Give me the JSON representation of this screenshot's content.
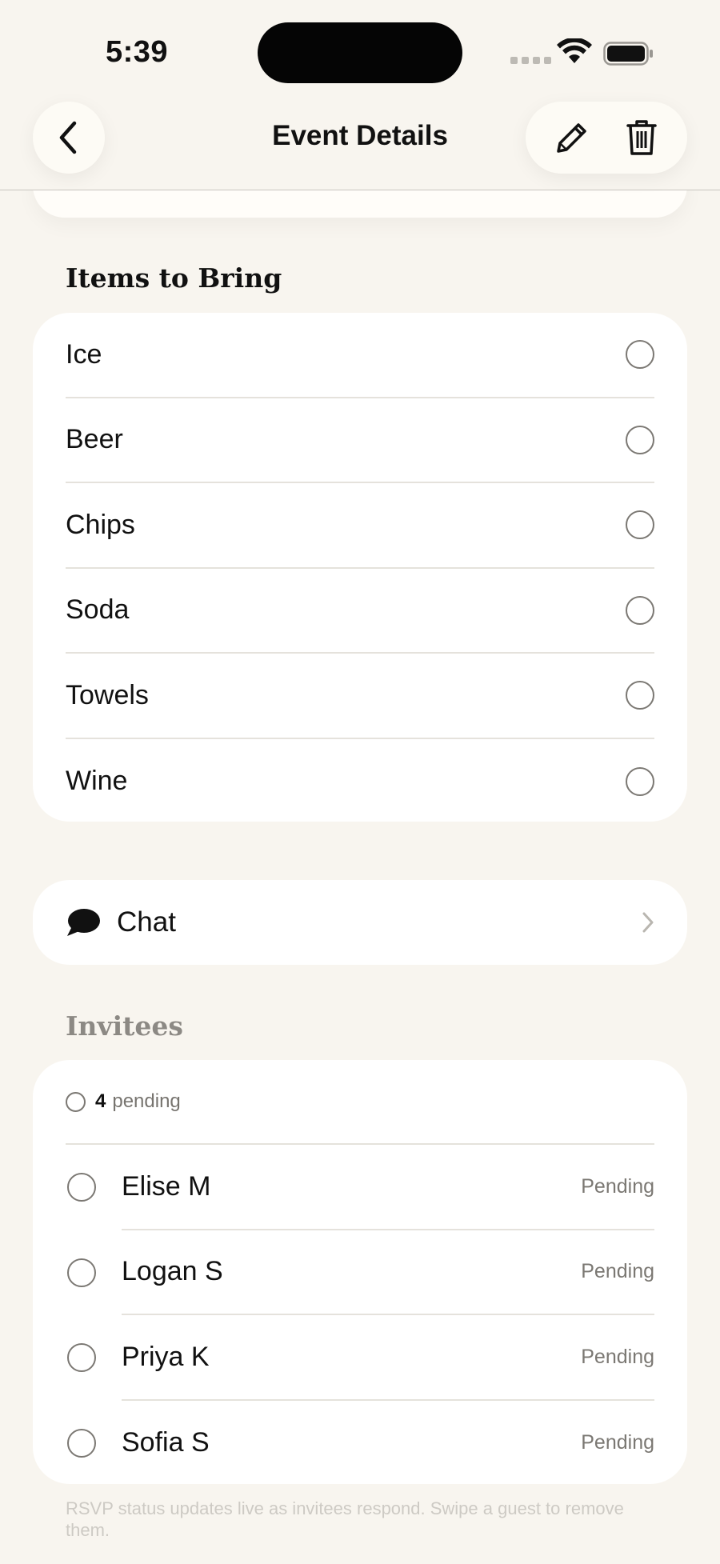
{
  "status_bar": {
    "time": "5:39"
  },
  "nav": {
    "title": "Event Details"
  },
  "items_section": {
    "title": "Items to Bring",
    "items": [
      {
        "label": "Ice"
      },
      {
        "label": "Beer"
      },
      {
        "label": "Chips"
      },
      {
        "label": "Soda"
      },
      {
        "label": "Towels"
      },
      {
        "label": "Wine"
      }
    ]
  },
  "chat": {
    "label": "Chat"
  },
  "invitees": {
    "title": "Invitees",
    "pending_count": "4",
    "pending_label": "pending",
    "list": [
      {
        "name": "Elise M",
        "status": "Pending"
      },
      {
        "name": "Logan S",
        "status": "Pending"
      },
      {
        "name": "Priya K",
        "status": "Pending"
      },
      {
        "name": "Sofia S",
        "status": "Pending"
      }
    ],
    "footnote": "RSVP status updates live as invitees respond. Swipe a guest to remove them."
  },
  "icons": {
    "back": "chevron-left-icon",
    "edit": "pencil-icon",
    "delete": "trash-icon",
    "chat": "speech-bubble-icon",
    "chat_arrow": "chevron-right-icon"
  }
}
